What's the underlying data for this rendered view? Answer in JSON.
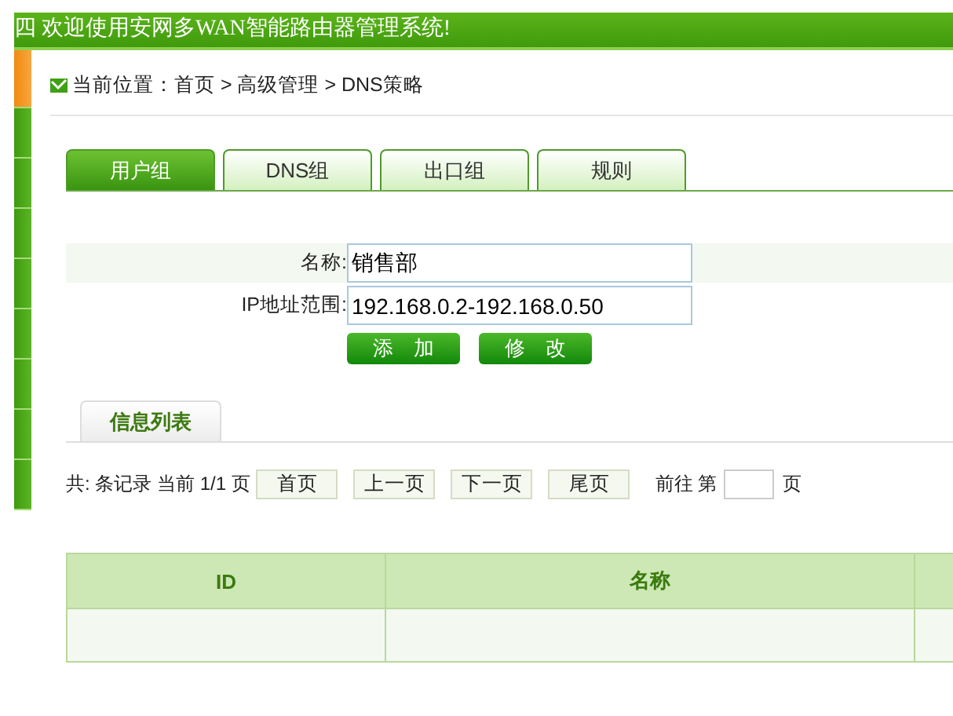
{
  "header": {
    "title": "四 欢迎使用安网多WAN智能路由器管理系统!"
  },
  "sidebar": {
    "items": [
      {
        "selected": true
      },
      {
        "selected": false
      },
      {
        "selected": false
      },
      {
        "selected": false
      },
      {
        "selected": false
      },
      {
        "selected": false
      },
      {
        "selected": false
      },
      {
        "selected": false
      },
      {
        "selected": false
      }
    ]
  },
  "breadcrumb": "当前位置：首页 > 高级管理 > DNS策略",
  "tabs": [
    {
      "label": "用户组",
      "selected": true
    },
    {
      "label": "DNS组",
      "selected": false
    },
    {
      "label": "出口组",
      "selected": false
    },
    {
      "label": "规则",
      "selected": false
    }
  ],
  "form": {
    "fields": [
      {
        "label": "名称:",
        "value": "销售部"
      },
      {
        "label": "IP地址范围:",
        "value": "192.168.0.2-192.168.0.50"
      }
    ],
    "buttons": [
      "添　加",
      "修　改"
    ]
  },
  "list_tab": "信息列表",
  "pagination": {
    "summary": "共: 条记录 当前 1/1 页",
    "buttons": [
      "首页",
      "上一页",
      "下一页",
      "尾页"
    ],
    "goto_label": "前往 第",
    "page_suffix": "页"
  },
  "table": {
    "columns": [
      {
        "label": "ID"
      },
      {
        "label": "名称"
      }
    ]
  }
}
